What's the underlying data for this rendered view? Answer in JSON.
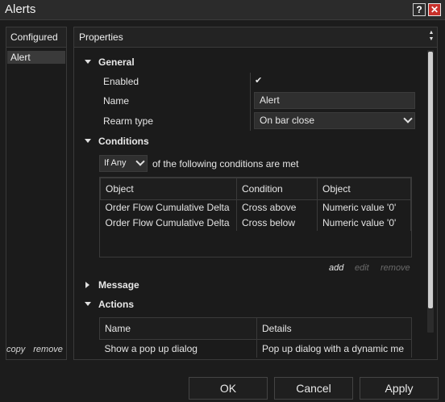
{
  "window": {
    "title": "Alerts",
    "help_glyph": "?",
    "close_glyph": "✕"
  },
  "left": {
    "header": "Configured",
    "items": [
      "Alert"
    ],
    "copy_label": "copy",
    "remove_label": "remove"
  },
  "right": {
    "header": "Properties",
    "general": {
      "title": "General",
      "enabled_label": "Enabled",
      "enabled_check": "✔",
      "name_label": "Name",
      "name_value": "Alert",
      "rearm_label": "Rearm type",
      "rearm_value": "On bar close"
    },
    "conditions": {
      "title": "Conditions",
      "mode_value": "If Any",
      "mode_suffix": "of the following conditions are met",
      "columns": [
        "Object",
        "Condition",
        "Object"
      ],
      "rows": [
        [
          "Order Flow Cumulative Delta",
          "Cross above",
          "Numeric value '0'"
        ],
        [
          "Order Flow Cumulative Delta",
          "Cross below",
          "Numeric value '0'"
        ]
      ],
      "add_label": "add",
      "edit_label": "edit",
      "remove_label": "remove"
    },
    "message": {
      "title": "Message"
    },
    "actions": {
      "title": "Actions",
      "columns": [
        "Name",
        "Details"
      ],
      "rows": [
        [
          "Show a pop up dialog",
          "Pop up dialog with a dynamic me"
        ]
      ]
    }
  },
  "buttons": {
    "ok": "OK",
    "cancel": "Cancel",
    "apply": "Apply"
  },
  "colors": {
    "background": "#1c1c1c",
    "close_button": "#c8302a",
    "text": "#e4e4e4"
  }
}
